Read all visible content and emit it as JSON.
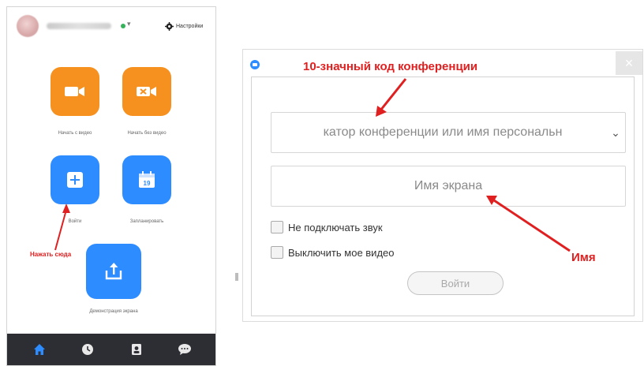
{
  "zoom_home": {
    "settings_label": "Настройки",
    "tiles": [
      {
        "label": "Начать с видео",
        "icon": "video-camera-icon",
        "color": "#f6901e"
      },
      {
        "label": "Начать без видео",
        "icon": "video-off-icon",
        "color": "#f6901e"
      },
      {
        "label": "Войти",
        "icon": "plus-icon",
        "color": "#2d8cff"
      },
      {
        "label": "Запланировать",
        "icon": "calendar-icon",
        "color": "#2d8cff"
      },
      {
        "label": "Демонстрация экрана",
        "icon": "share-screen-icon",
        "color": "#2d8cff"
      }
    ],
    "calendar_day": "19",
    "bottom_nav": [
      "home-icon",
      "clock-icon",
      "contacts-icon",
      "chat-icon"
    ],
    "nav_color": "#2d2d34"
  },
  "join_dialog": {
    "meeting_id_field": "катор конференции или имя персональн",
    "screen_name_field": "Имя экрана",
    "no_audio_label": "Не подключать звук",
    "no_video_label": "Выключить мое видео",
    "join_button": "Войти",
    "close_icon": "×"
  },
  "annotations": {
    "meeting_code": "10-значный код конференции",
    "click_here": "Нажать сюда",
    "name": "Имя",
    "color": "#e02020"
  }
}
